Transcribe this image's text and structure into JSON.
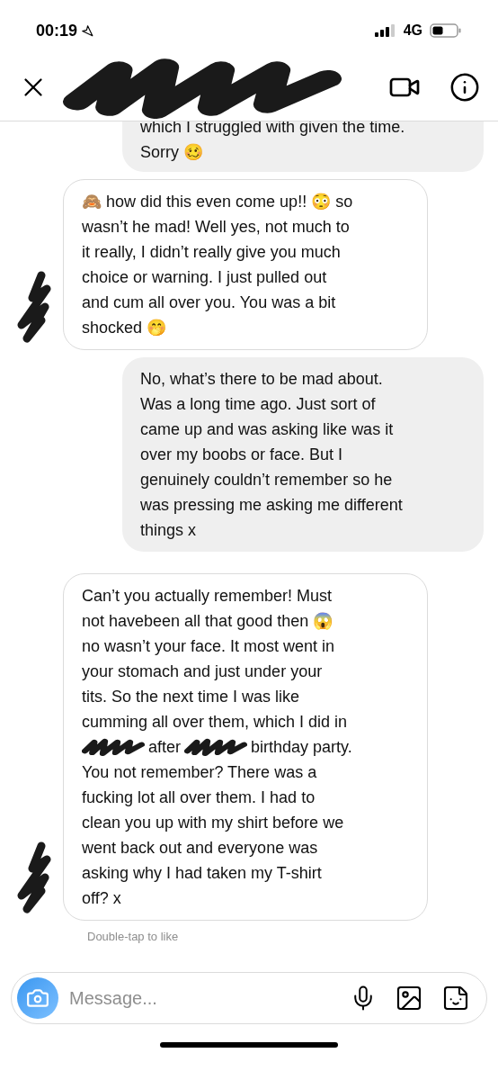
{
  "status_bar": {
    "time": "00:19",
    "network": "4G"
  },
  "header": {
    "name_redacted": true
  },
  "messages": [
    {
      "kind": "sent",
      "cut_top": true,
      "lines": [
        {
          "kind": "text",
          "text": "which I struggled with given the time."
        },
        {
          "kind": "text",
          "text": "Sorry 🥴"
        }
      ]
    },
    {
      "kind": "received",
      "avatar_redacted": true,
      "cut_top": false,
      "lines": [
        {
          "kind": "text",
          "text": "🙈 how did this even come up!! 😳 so"
        },
        {
          "kind": "text",
          "text": "wasn’t he mad! Well yes, not much to"
        },
        {
          "kind": "text",
          "text": "it really, I didn’t really give you much"
        },
        {
          "kind": "text",
          "text": "choice or warning. I just pulled out"
        },
        {
          "kind": "text",
          "text": "and cum all over you. You was a bit"
        },
        {
          "kind": "text",
          "text": "shocked 🤭"
        }
      ]
    },
    {
      "kind": "sent",
      "cut_top": false,
      "lines": [
        {
          "kind": "text",
          "text": "No, what’s there to be mad about."
        },
        {
          "kind": "text",
          "text": "Was a long time ago. Just sort of"
        },
        {
          "kind": "text",
          "text": "came up and was asking like was it"
        },
        {
          "kind": "text",
          "text": "over my boobs or face. But I"
        },
        {
          "kind": "text",
          "text": "genuinely couldn’t remember so he"
        },
        {
          "kind": "text",
          "text": "was pressing me asking me different"
        },
        {
          "kind": "text",
          "text": "things x"
        }
      ]
    },
    {
      "kind": "received",
      "avatar_redacted": true,
      "cut_top": false,
      "lines": [
        {
          "kind": "text",
          "text": "Can’t you actually remember! Must"
        },
        {
          "kind": "text",
          "text": "not havebeen all that good then 😱"
        },
        {
          "kind": "text",
          "text": "no wasn’t your face. It most went in"
        },
        {
          "kind": "text",
          "text": "your stomach and just under your"
        },
        {
          "kind": "text",
          "text": "tits. So the next time I was like"
        },
        {
          "kind": "text",
          "text": "cumming all over them, which I did in"
        },
        {
          "kind": "mixed",
          "segments": [
            {
              "kind": "redaction"
            },
            {
              "kind": "text",
              "text": "after"
            },
            {
              "kind": "redaction"
            },
            {
              "kind": "text",
              "text": "birthday party."
            }
          ]
        },
        {
          "kind": "text",
          "text": "You not remember? There was a"
        },
        {
          "kind": "text",
          "text": "fucking lot all over them. I had to"
        },
        {
          "kind": "text",
          "text": "clean you up with my shirt before we"
        },
        {
          "kind": "text",
          "text": "went back out and everyone was"
        },
        {
          "kind": "text",
          "text": "asking why I had taken my T-shirt"
        },
        {
          "kind": "text",
          "text": "off? x"
        }
      ]
    }
  ],
  "hint": "Double-tap to like",
  "composer": {
    "placeholder": "Message..."
  }
}
